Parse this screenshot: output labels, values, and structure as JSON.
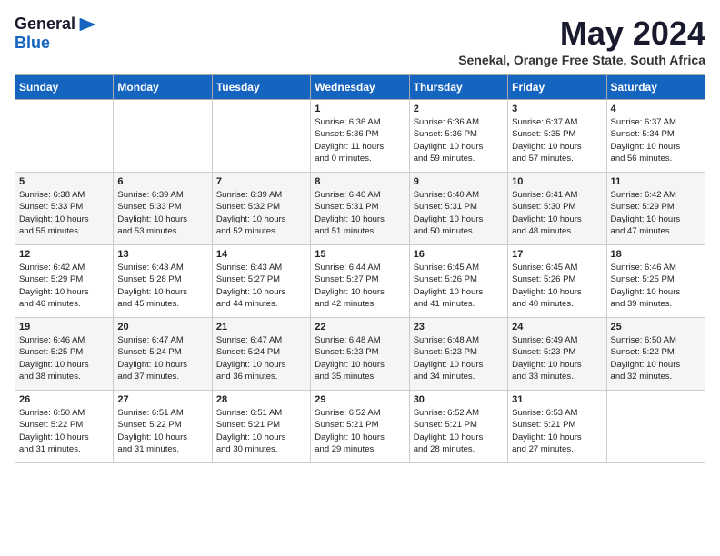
{
  "header": {
    "logo_general": "General",
    "logo_blue": "Blue",
    "month_title": "May 2024",
    "location": "Senekal, Orange Free State, South Africa"
  },
  "weekdays": [
    "Sunday",
    "Monday",
    "Tuesday",
    "Wednesday",
    "Thursday",
    "Friday",
    "Saturday"
  ],
  "weeks": [
    [
      {
        "day": "",
        "info": ""
      },
      {
        "day": "",
        "info": ""
      },
      {
        "day": "",
        "info": ""
      },
      {
        "day": "1",
        "info": "Sunrise: 6:36 AM\nSunset: 5:36 PM\nDaylight: 11 hours\nand 0 minutes."
      },
      {
        "day": "2",
        "info": "Sunrise: 6:36 AM\nSunset: 5:36 PM\nDaylight: 10 hours\nand 59 minutes."
      },
      {
        "day": "3",
        "info": "Sunrise: 6:37 AM\nSunset: 5:35 PM\nDaylight: 10 hours\nand 57 minutes."
      },
      {
        "day": "4",
        "info": "Sunrise: 6:37 AM\nSunset: 5:34 PM\nDaylight: 10 hours\nand 56 minutes."
      }
    ],
    [
      {
        "day": "5",
        "info": "Sunrise: 6:38 AM\nSunset: 5:33 PM\nDaylight: 10 hours\nand 55 minutes."
      },
      {
        "day": "6",
        "info": "Sunrise: 6:39 AM\nSunset: 5:33 PM\nDaylight: 10 hours\nand 53 minutes."
      },
      {
        "day": "7",
        "info": "Sunrise: 6:39 AM\nSunset: 5:32 PM\nDaylight: 10 hours\nand 52 minutes."
      },
      {
        "day": "8",
        "info": "Sunrise: 6:40 AM\nSunset: 5:31 PM\nDaylight: 10 hours\nand 51 minutes."
      },
      {
        "day": "9",
        "info": "Sunrise: 6:40 AM\nSunset: 5:31 PM\nDaylight: 10 hours\nand 50 minutes."
      },
      {
        "day": "10",
        "info": "Sunrise: 6:41 AM\nSunset: 5:30 PM\nDaylight: 10 hours\nand 48 minutes."
      },
      {
        "day": "11",
        "info": "Sunrise: 6:42 AM\nSunset: 5:29 PM\nDaylight: 10 hours\nand 47 minutes."
      }
    ],
    [
      {
        "day": "12",
        "info": "Sunrise: 6:42 AM\nSunset: 5:29 PM\nDaylight: 10 hours\nand 46 minutes."
      },
      {
        "day": "13",
        "info": "Sunrise: 6:43 AM\nSunset: 5:28 PM\nDaylight: 10 hours\nand 45 minutes."
      },
      {
        "day": "14",
        "info": "Sunrise: 6:43 AM\nSunset: 5:27 PM\nDaylight: 10 hours\nand 44 minutes."
      },
      {
        "day": "15",
        "info": "Sunrise: 6:44 AM\nSunset: 5:27 PM\nDaylight: 10 hours\nand 42 minutes."
      },
      {
        "day": "16",
        "info": "Sunrise: 6:45 AM\nSunset: 5:26 PM\nDaylight: 10 hours\nand 41 minutes."
      },
      {
        "day": "17",
        "info": "Sunrise: 6:45 AM\nSunset: 5:26 PM\nDaylight: 10 hours\nand 40 minutes."
      },
      {
        "day": "18",
        "info": "Sunrise: 6:46 AM\nSunset: 5:25 PM\nDaylight: 10 hours\nand 39 minutes."
      }
    ],
    [
      {
        "day": "19",
        "info": "Sunrise: 6:46 AM\nSunset: 5:25 PM\nDaylight: 10 hours\nand 38 minutes."
      },
      {
        "day": "20",
        "info": "Sunrise: 6:47 AM\nSunset: 5:24 PM\nDaylight: 10 hours\nand 37 minutes."
      },
      {
        "day": "21",
        "info": "Sunrise: 6:47 AM\nSunset: 5:24 PM\nDaylight: 10 hours\nand 36 minutes."
      },
      {
        "day": "22",
        "info": "Sunrise: 6:48 AM\nSunset: 5:23 PM\nDaylight: 10 hours\nand 35 minutes."
      },
      {
        "day": "23",
        "info": "Sunrise: 6:48 AM\nSunset: 5:23 PM\nDaylight: 10 hours\nand 34 minutes."
      },
      {
        "day": "24",
        "info": "Sunrise: 6:49 AM\nSunset: 5:23 PM\nDaylight: 10 hours\nand 33 minutes."
      },
      {
        "day": "25",
        "info": "Sunrise: 6:50 AM\nSunset: 5:22 PM\nDaylight: 10 hours\nand 32 minutes."
      }
    ],
    [
      {
        "day": "26",
        "info": "Sunrise: 6:50 AM\nSunset: 5:22 PM\nDaylight: 10 hours\nand 31 minutes."
      },
      {
        "day": "27",
        "info": "Sunrise: 6:51 AM\nSunset: 5:22 PM\nDaylight: 10 hours\nand 31 minutes."
      },
      {
        "day": "28",
        "info": "Sunrise: 6:51 AM\nSunset: 5:21 PM\nDaylight: 10 hours\nand 30 minutes."
      },
      {
        "day": "29",
        "info": "Sunrise: 6:52 AM\nSunset: 5:21 PM\nDaylight: 10 hours\nand 29 minutes."
      },
      {
        "day": "30",
        "info": "Sunrise: 6:52 AM\nSunset: 5:21 PM\nDaylight: 10 hours\nand 28 minutes."
      },
      {
        "day": "31",
        "info": "Sunrise: 6:53 AM\nSunset: 5:21 PM\nDaylight: 10 hours\nand 27 minutes."
      },
      {
        "day": "",
        "info": ""
      }
    ]
  ]
}
